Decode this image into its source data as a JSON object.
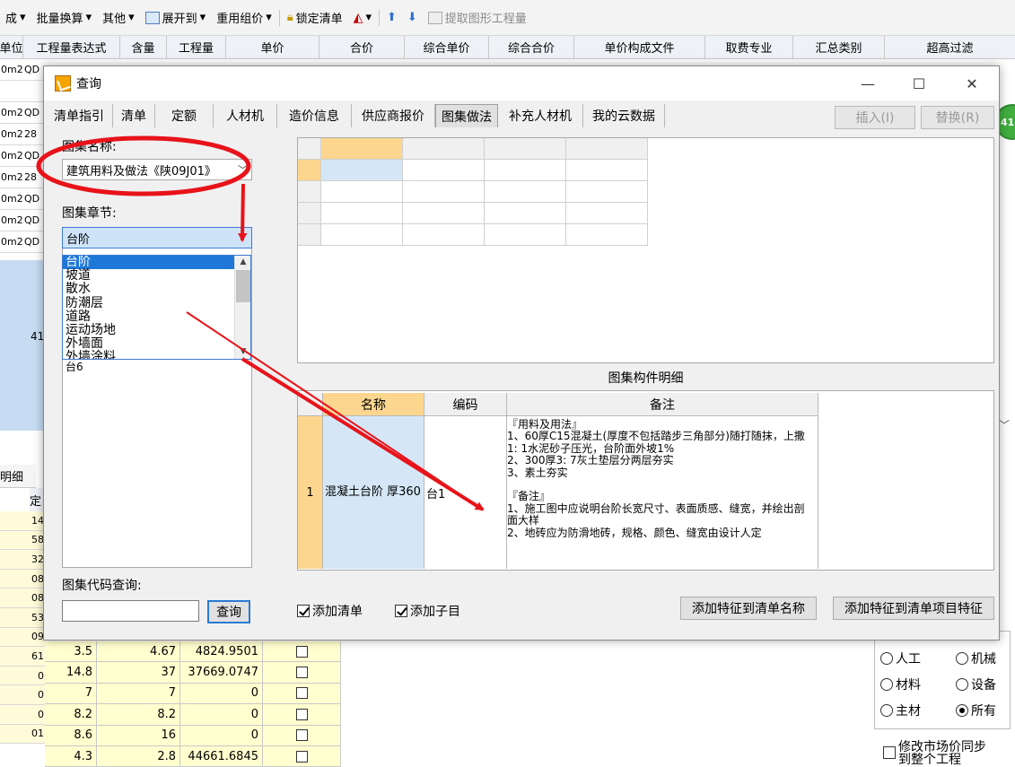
{
  "toolbar": {
    "items": [
      "成",
      "批量换算",
      "其他",
      "展开到",
      "重用组价",
      "锁定清单",
      "提取图形工程量"
    ]
  },
  "grid": {
    "headers": [
      "单位",
      "工程量表达式",
      "含量",
      "工程量",
      "单价",
      "合价",
      "综合单价",
      "综合合价",
      "单价构成文件",
      "取费专业",
      "汇总类别",
      "超高过滤"
    ],
    "left_col": [
      "0m2",
      "",
      "0m2",
      "0m2",
      "0m2",
      "0m2",
      "0m2",
      "0m2",
      "0m2"
    ],
    "left_col2": [
      "QD",
      "",
      "QD",
      "28",
      "QD",
      "28",
      "QD",
      "QD",
      "QD"
    ],
    "side_value": "41"
  },
  "lower": {
    "tab_label": "明细",
    "left_values": [
      "14",
      "58",
      "32",
      "08",
      "08",
      "53",
      "09",
      "61",
      "0",
      "0",
      "0",
      "01"
    ],
    "col_header": "定",
    "rows": [
      {
        "a": "3.5",
        "b": "4.67",
        "c": "4824.9501"
      },
      {
        "a": "14.8",
        "b": "37",
        "c": "37669.0747"
      },
      {
        "a": "7",
        "b": "7",
        "c": "0"
      },
      {
        "a": "8.2",
        "b": "8.2",
        "c": "0"
      },
      {
        "a": "8.6",
        "b": "16",
        "c": "0"
      },
      {
        "a": "4.3",
        "b": "2.8",
        "c": "44661.6845"
      }
    ]
  },
  "radios": {
    "options": [
      "人工",
      "机械",
      "材料",
      "设备",
      "主材",
      "所有"
    ],
    "selected": "所有"
  },
  "sync_label": "修改市场价同步到整个工程",
  "badge": "41",
  "dialog": {
    "title": "查询",
    "tabs": [
      "清单指引",
      "清单",
      "定额",
      "人材机",
      "造价信息",
      "供应商报价",
      "图集做法",
      "补充人材机",
      "我的云数据"
    ],
    "active_tab": "图集做法",
    "insert_label": "插入(I)",
    "replace_label": "替换(R)",
    "atlas_name_label": "图集名称:",
    "atlas_name_value": "建筑用料及做法《陕09J01》",
    "chapter_label": "图集章节:",
    "chapter_value": "台阶",
    "chapter_options": [
      "台阶",
      "坡道",
      "散水",
      "防潮层",
      "道路",
      "运动场地",
      "外墙面",
      "外墙涂料"
    ],
    "behind_item": "台6",
    "code_query_label": "图集代码查询:",
    "query_button": "查询",
    "detail_title": "图集构件明细",
    "detail_headers": {
      "name": "名称",
      "code": "编码",
      "remark": "备注"
    },
    "detail_row": {
      "index": "1",
      "name": "混凝土台阶 厚360",
      "code": "台1",
      "remark": "『用料及用法』\n1、60厚C15混凝土(厚度不包括踏步三角部分)随打随抹，上撒1: 1水泥砂子压光，台阶面外坡1%\n2、300厚3: 7灰土垫层分两层夯实\n3、素土夯实\n\n『备注』\n1、施工图中应说明台阶长宽尺寸、表面质感、缝宽，并绘出剖面大样\n2、地砖应为防滑地砖，规格、颜色、缝宽由设计人定"
    },
    "add_list_label": "添加清单",
    "add_child_label": "添加子目",
    "add_feature_name_btn": "添加特征到清单名称",
    "add_feature_item_btn": "添加特征到清单项目特征"
  }
}
